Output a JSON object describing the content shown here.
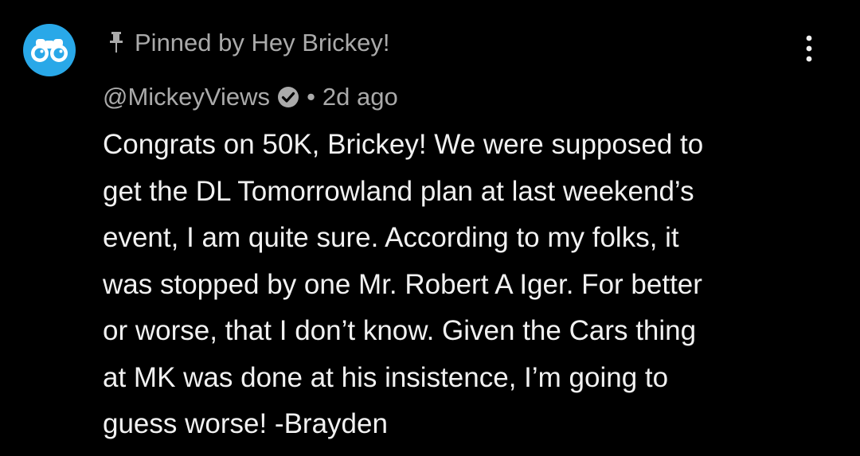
{
  "pinned": {
    "icon": "pin-icon",
    "label": "Pinned by Hey Brickey!"
  },
  "comment": {
    "avatar_icon": "binoculars-icon",
    "avatar_color": "#29a8e8",
    "author": "@MickeyViews",
    "verified_icon": "verified-check-icon",
    "separator": "•",
    "time": "2d ago",
    "menu_icon": "more-vertical-icon",
    "body_lines": [
      "Congrats on 50K, Brickey! We were supposed to",
      "get the DL Tomorrowland plan at last weekend’s",
      "event, I am quite sure. According to my folks, it",
      "was stopped by one Mr. Robert A Iger. For better",
      "or worse, that I don’t know. Given the Cars thing",
      "at MK was done at his insistence, I’m going to",
      "guess worse! -Brayden"
    ]
  }
}
